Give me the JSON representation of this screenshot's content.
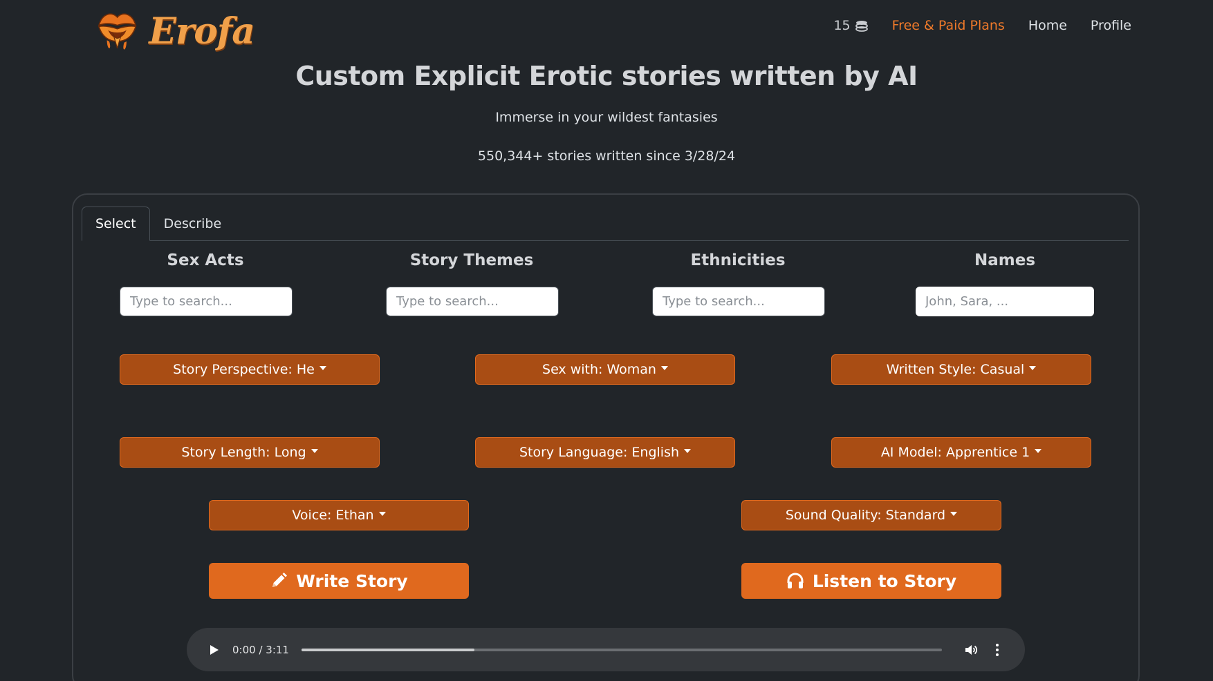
{
  "brand": {
    "name": "Erofa"
  },
  "nav": {
    "credits": "15",
    "plans": "Free & Paid Plans",
    "home": "Home",
    "profile": "Profile"
  },
  "hero": {
    "title": "Custom Explicit Erotic stories written by AI",
    "subtitle": "Immerse in your wildest fantasies",
    "count": "550,344+ stories written since 3/28/24"
  },
  "tabs": [
    {
      "label": "Select",
      "active": true
    },
    {
      "label": "Describe",
      "active": false
    }
  ],
  "columns": {
    "sex_acts": {
      "label": "Sex Acts",
      "placeholder": "Type to search..."
    },
    "themes": {
      "label": "Story Themes",
      "placeholder": "Type to search..."
    },
    "ethnicities": {
      "label": "Ethnicities",
      "placeholder": "Type to search..."
    },
    "names": {
      "label": "Names",
      "placeholder": "John, Sara, ..."
    }
  },
  "dropdowns": {
    "perspective": "Story Perspective: He",
    "sex_with": "Sex with: Woman",
    "style": "Written Style: Casual",
    "length": "Story Length: Long",
    "language": "Story Language: English",
    "model": "AI Model: Apprentice 1",
    "voice": "Voice: Ethan",
    "quality": "Sound Quality: Standard"
  },
  "actions": {
    "write": "Write Story",
    "listen": "Listen to Story"
  },
  "player": {
    "time": "0:00 / 3:11",
    "buffered_fraction": 0.27
  },
  "colors": {
    "accent": "#e0691e",
    "dropdown": "#a94d14",
    "background": "#212529"
  },
  "icons": {
    "coins": "coins-icon",
    "clear": "close-icon",
    "write": "pencil-icon",
    "listen": "headphones-icon",
    "play": "play-icon",
    "volume": "volume-icon",
    "more": "more-vertical-icon"
  }
}
